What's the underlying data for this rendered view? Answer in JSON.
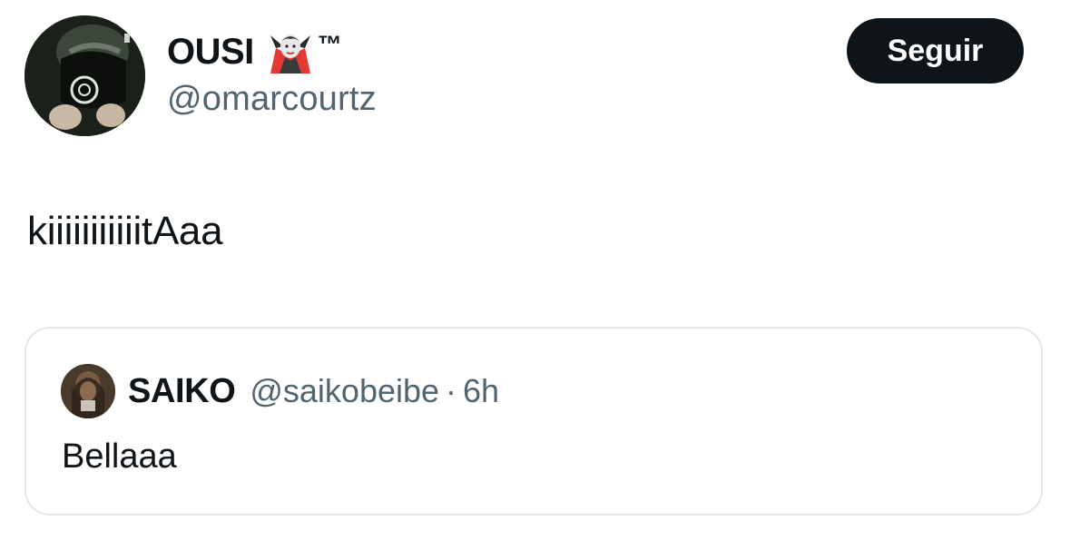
{
  "tweet": {
    "author": {
      "display_name": "OUSI",
      "name_emoji": "vampire-emoji",
      "trademark": "™",
      "handle": "@omarcourtz"
    },
    "follow_label": "Seguir",
    "text": "kiiiiiiiiiiitAaa",
    "quoted": {
      "display_name": "SAIKO",
      "handle": "@saikobeibe",
      "separator": "·",
      "time": "6h",
      "text": "Bellaaa"
    }
  },
  "colors": {
    "text_primary": "#0f1419",
    "text_secondary": "#536471",
    "button_bg": "#0f1419",
    "button_text": "#ffffff",
    "card_border": "#e1e8ed"
  }
}
